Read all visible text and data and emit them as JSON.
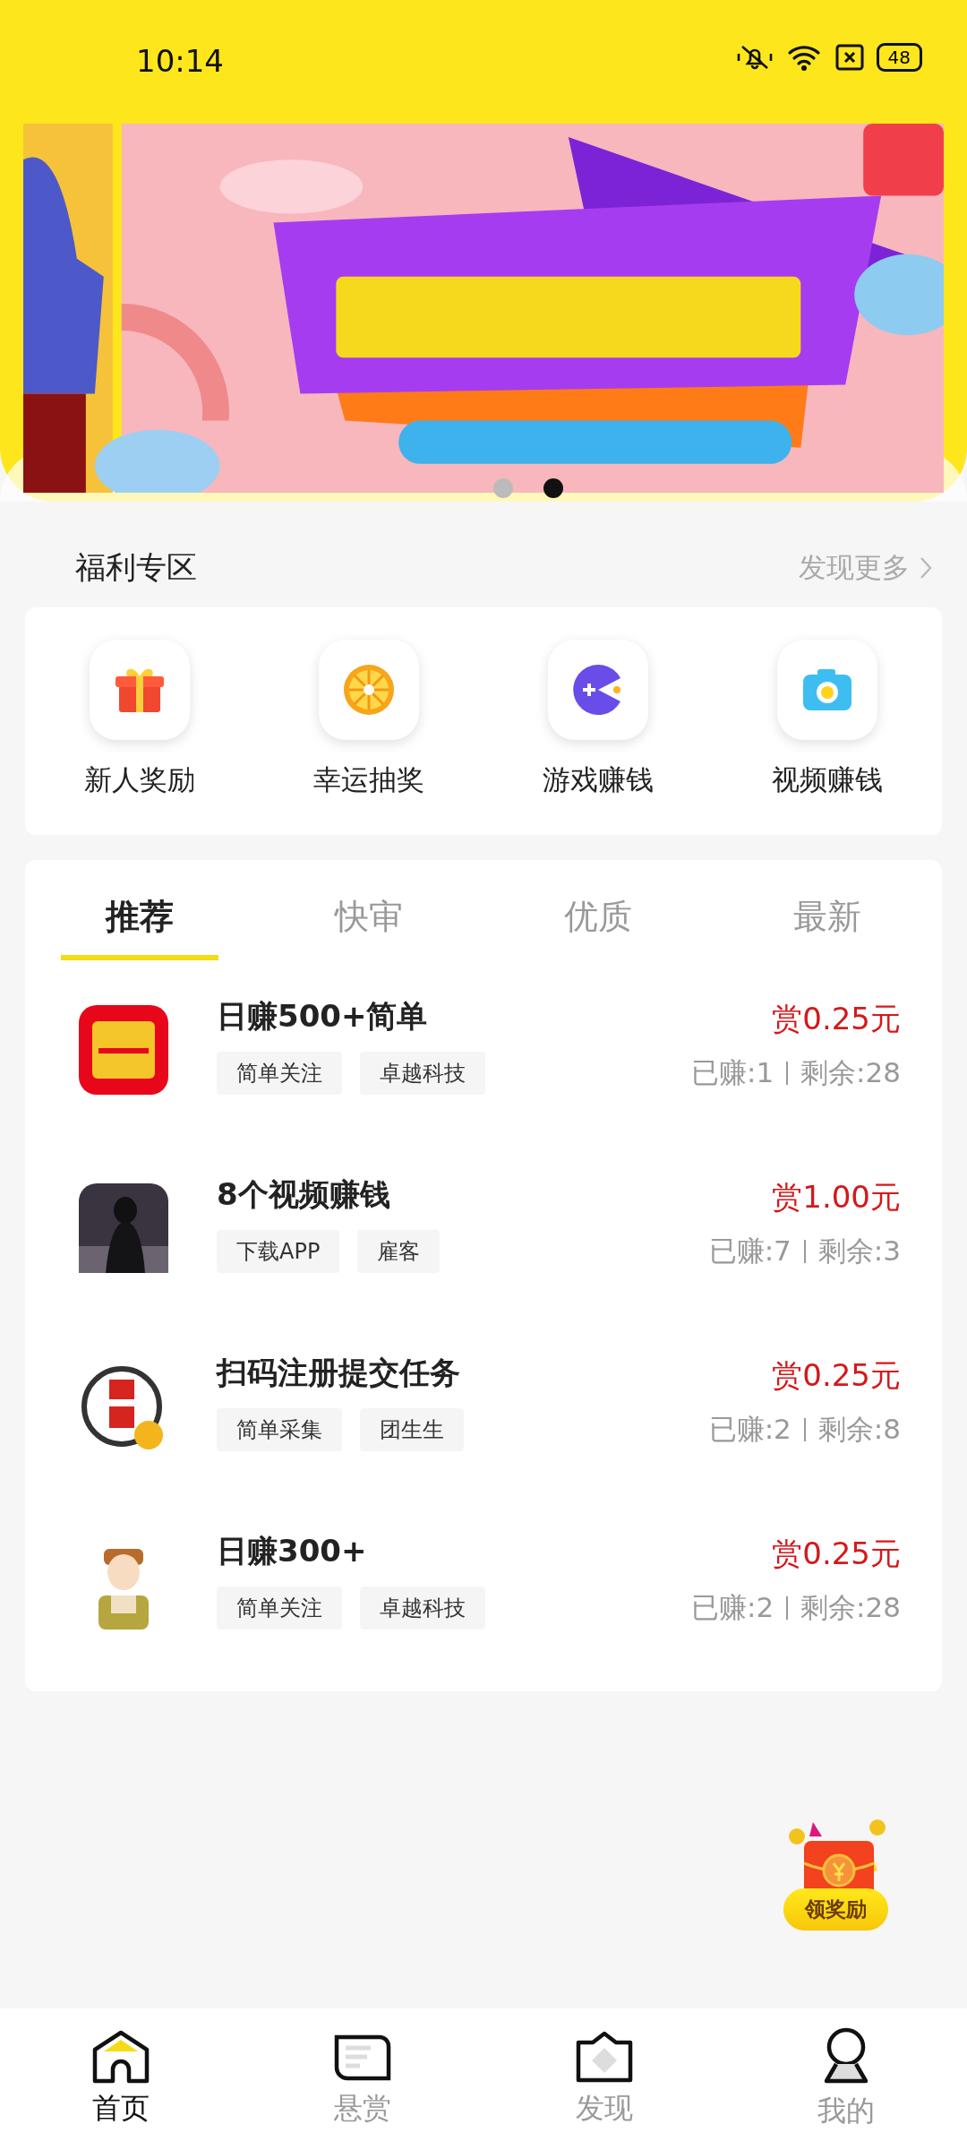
{
  "status_bar": {
    "time": "10:14",
    "battery": "48"
  },
  "banner": {
    "dots": [
      {
        "selected": false
      },
      {
        "selected": true
      }
    ]
  },
  "welfare": {
    "title": "福利专区",
    "more": "发现更多",
    "items": [
      {
        "label": "新人奖励"
      },
      {
        "label": "幸运抽奖"
      },
      {
        "label": "游戏赚钱"
      },
      {
        "label": "视频赚钱"
      }
    ]
  },
  "tabs": [
    {
      "label": "推荐",
      "selected": true
    },
    {
      "label": "快审",
      "selected": false
    },
    {
      "label": "优质",
      "selected": false
    },
    {
      "label": "最新",
      "selected": false
    }
  ],
  "tasks": [
    {
      "title": "日赚500+简单",
      "tags": [
        "简单关注",
        "卓越科技"
      ],
      "reward": "赏0.25元",
      "earned": "已赚:1",
      "remaining": "剩余:28"
    },
    {
      "title": "8个视频赚钱",
      "tags": [
        "下载APP",
        "雇客"
      ],
      "reward": "赏1.00元",
      "earned": "已赚:7",
      "remaining": "剩余:3"
    },
    {
      "title": "扫码注册提交任务",
      "tags": [
        "简单采集",
        "团生生"
      ],
      "reward": "赏0.25元",
      "earned": "已赚:2",
      "remaining": "剩余:8"
    },
    {
      "title": "日赚300+",
      "tags": [
        "简单关注",
        "卓越科技"
      ],
      "reward": "赏0.25元",
      "earned": "已赚:2",
      "remaining": "剩余:28"
    }
  ],
  "reward_button": {
    "label": "领奖励"
  },
  "bottom_nav": [
    {
      "label": "首页",
      "selected": true
    },
    {
      "label": "悬赏",
      "selected": false
    },
    {
      "label": "发现",
      "selected": false
    },
    {
      "label": "我的",
      "selected": false
    }
  ]
}
